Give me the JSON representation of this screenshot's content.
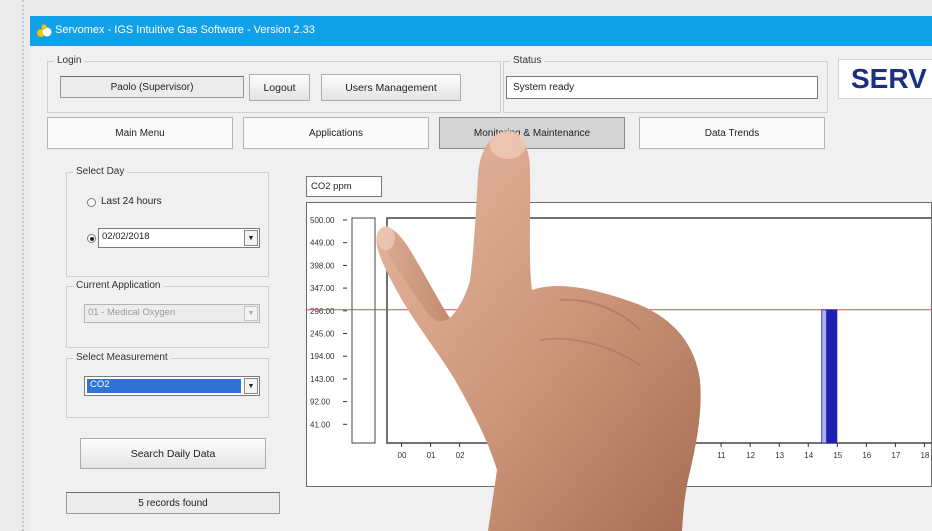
{
  "window": {
    "title": "Servomex - IGS Intuitive Gas Software - Version 2.33"
  },
  "login": {
    "group_label": "Login",
    "user": "Paolo (Supervisor)",
    "logout_label": "Logout",
    "users_management_label": "Users Management"
  },
  "status": {
    "group_label": "Status",
    "text": "System ready"
  },
  "logo": {
    "text": "SERV"
  },
  "tabs": [
    {
      "label": "Main Menu"
    },
    {
      "label": "Applications"
    },
    {
      "label": "Monitoring & Maintenance",
      "active": true
    },
    {
      "label": "Data Trends"
    }
  ],
  "select_day": {
    "group_label": "Select Day",
    "option_24h_label": "Last 24 hours",
    "option_24h_checked": false,
    "option_date_checked": true,
    "date_value": "02/02/2018"
  },
  "current_application": {
    "group_label": "Current Application",
    "value": "01 - Medical Oxygen"
  },
  "select_measurement": {
    "group_label": "Select Measurement",
    "value": "CO2"
  },
  "search": {
    "button_label": "Search Daily Data"
  },
  "records": {
    "text": "5 records found"
  },
  "chart_data": {
    "type": "bar",
    "title": "CO2 ppm",
    "y_ticks": [
      "500.00",
      "449.00",
      "398.00",
      "347.00",
      "296.00",
      "245.00",
      "194.00",
      "143.00",
      "92.00",
      "41.00"
    ],
    "ylim": [
      0,
      500
    ],
    "threshold": 296,
    "threshold_color": "#e8484d",
    "x_ticks": [
      "00",
      "01",
      "02",
      "11",
      "12",
      "13",
      "14",
      "15",
      "16",
      "17",
      "18"
    ],
    "xlim": [
      -0.5,
      18.5
    ],
    "bars": [
      {
        "x": 14.55,
        "value": 296,
        "color": "#aab2e6"
      },
      {
        "x": 14.72,
        "value": 296,
        "color": "#1f1fb3"
      },
      {
        "x": 14.9,
        "value": 296,
        "color": "#1f1fb3"
      }
    ],
    "bar_edge_color": "#1f1fb3",
    "grid": false
  }
}
